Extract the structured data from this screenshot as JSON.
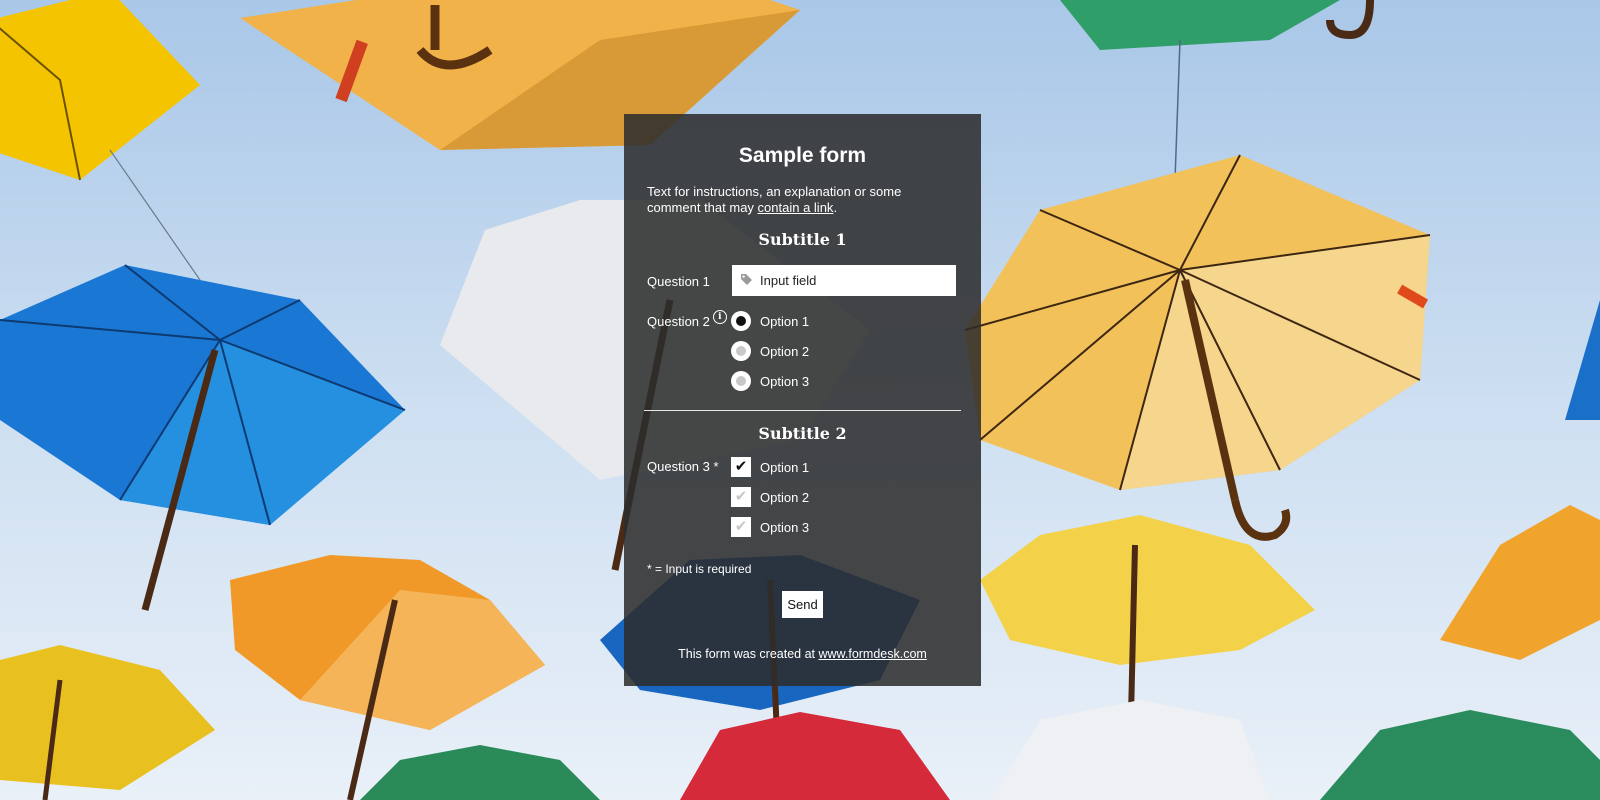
{
  "form": {
    "title": "Sample form",
    "intro_text": "Text for instructions, an explanation or some comment that may ",
    "intro_link": "contain a link",
    "intro_end": ".",
    "sections": [
      {
        "subtitle": "Subtitle 1",
        "question1": {
          "label": "Question 1",
          "input_placeholder": "Input field",
          "icon": "tag-icon"
        },
        "question2": {
          "label": "Question 2",
          "icon": "info-icon",
          "options": [
            "Option 1",
            "Option 2",
            "Option 3"
          ],
          "selected": "Option 1"
        }
      },
      {
        "subtitle": "Subtitle 2",
        "question3": {
          "label": "Question 3 *",
          "options": [
            "Option 1",
            "Option 2",
            "Option 3"
          ],
          "checked": [
            "Option 1"
          ]
        }
      }
    ],
    "required_note": "* = Input is required",
    "send_label": "Send",
    "footer_text": "This form was created at ",
    "footer_link": "www.formdesk.com"
  },
  "colors": {
    "panel_bg": "#2d2d2d",
    "text": "#ffffff",
    "field_bg": "#ffffff"
  }
}
